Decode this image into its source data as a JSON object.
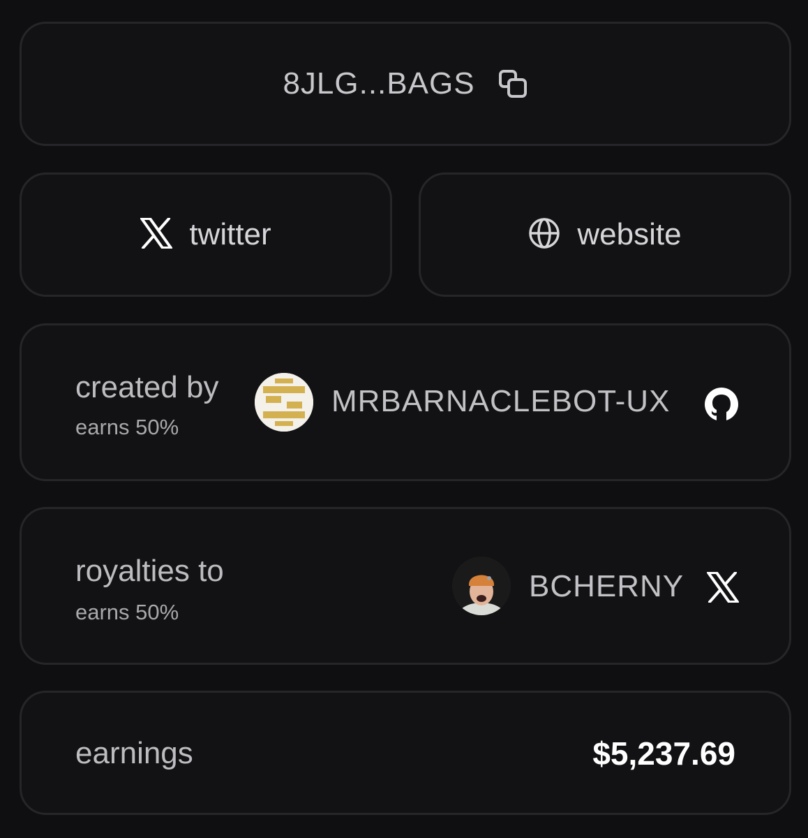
{
  "address": {
    "short": "8JLG...BAGS",
    "copy_icon": "copy-icon"
  },
  "links": {
    "twitter": {
      "label": "twitter",
      "icon": "x-logo-icon"
    },
    "website": {
      "label": "website",
      "icon": "globe-icon"
    }
  },
  "creator": {
    "label": "created by",
    "share": "earns 50%",
    "handle": "MRBARNACLEBOT-UX",
    "platform_icon": "github-icon"
  },
  "royalties": {
    "label": "royalties to",
    "share": "earns 50%",
    "handle": "BCHERNY",
    "platform_icon": "x-logo-icon"
  },
  "earnings": {
    "label": "earnings",
    "value": "$5,237.69"
  },
  "colors": {
    "background": "#0f0f11",
    "card_border": "#26262a",
    "text": "#c2c2c6",
    "value": "#ffffff",
    "avatar_gold": "#d4b150"
  }
}
